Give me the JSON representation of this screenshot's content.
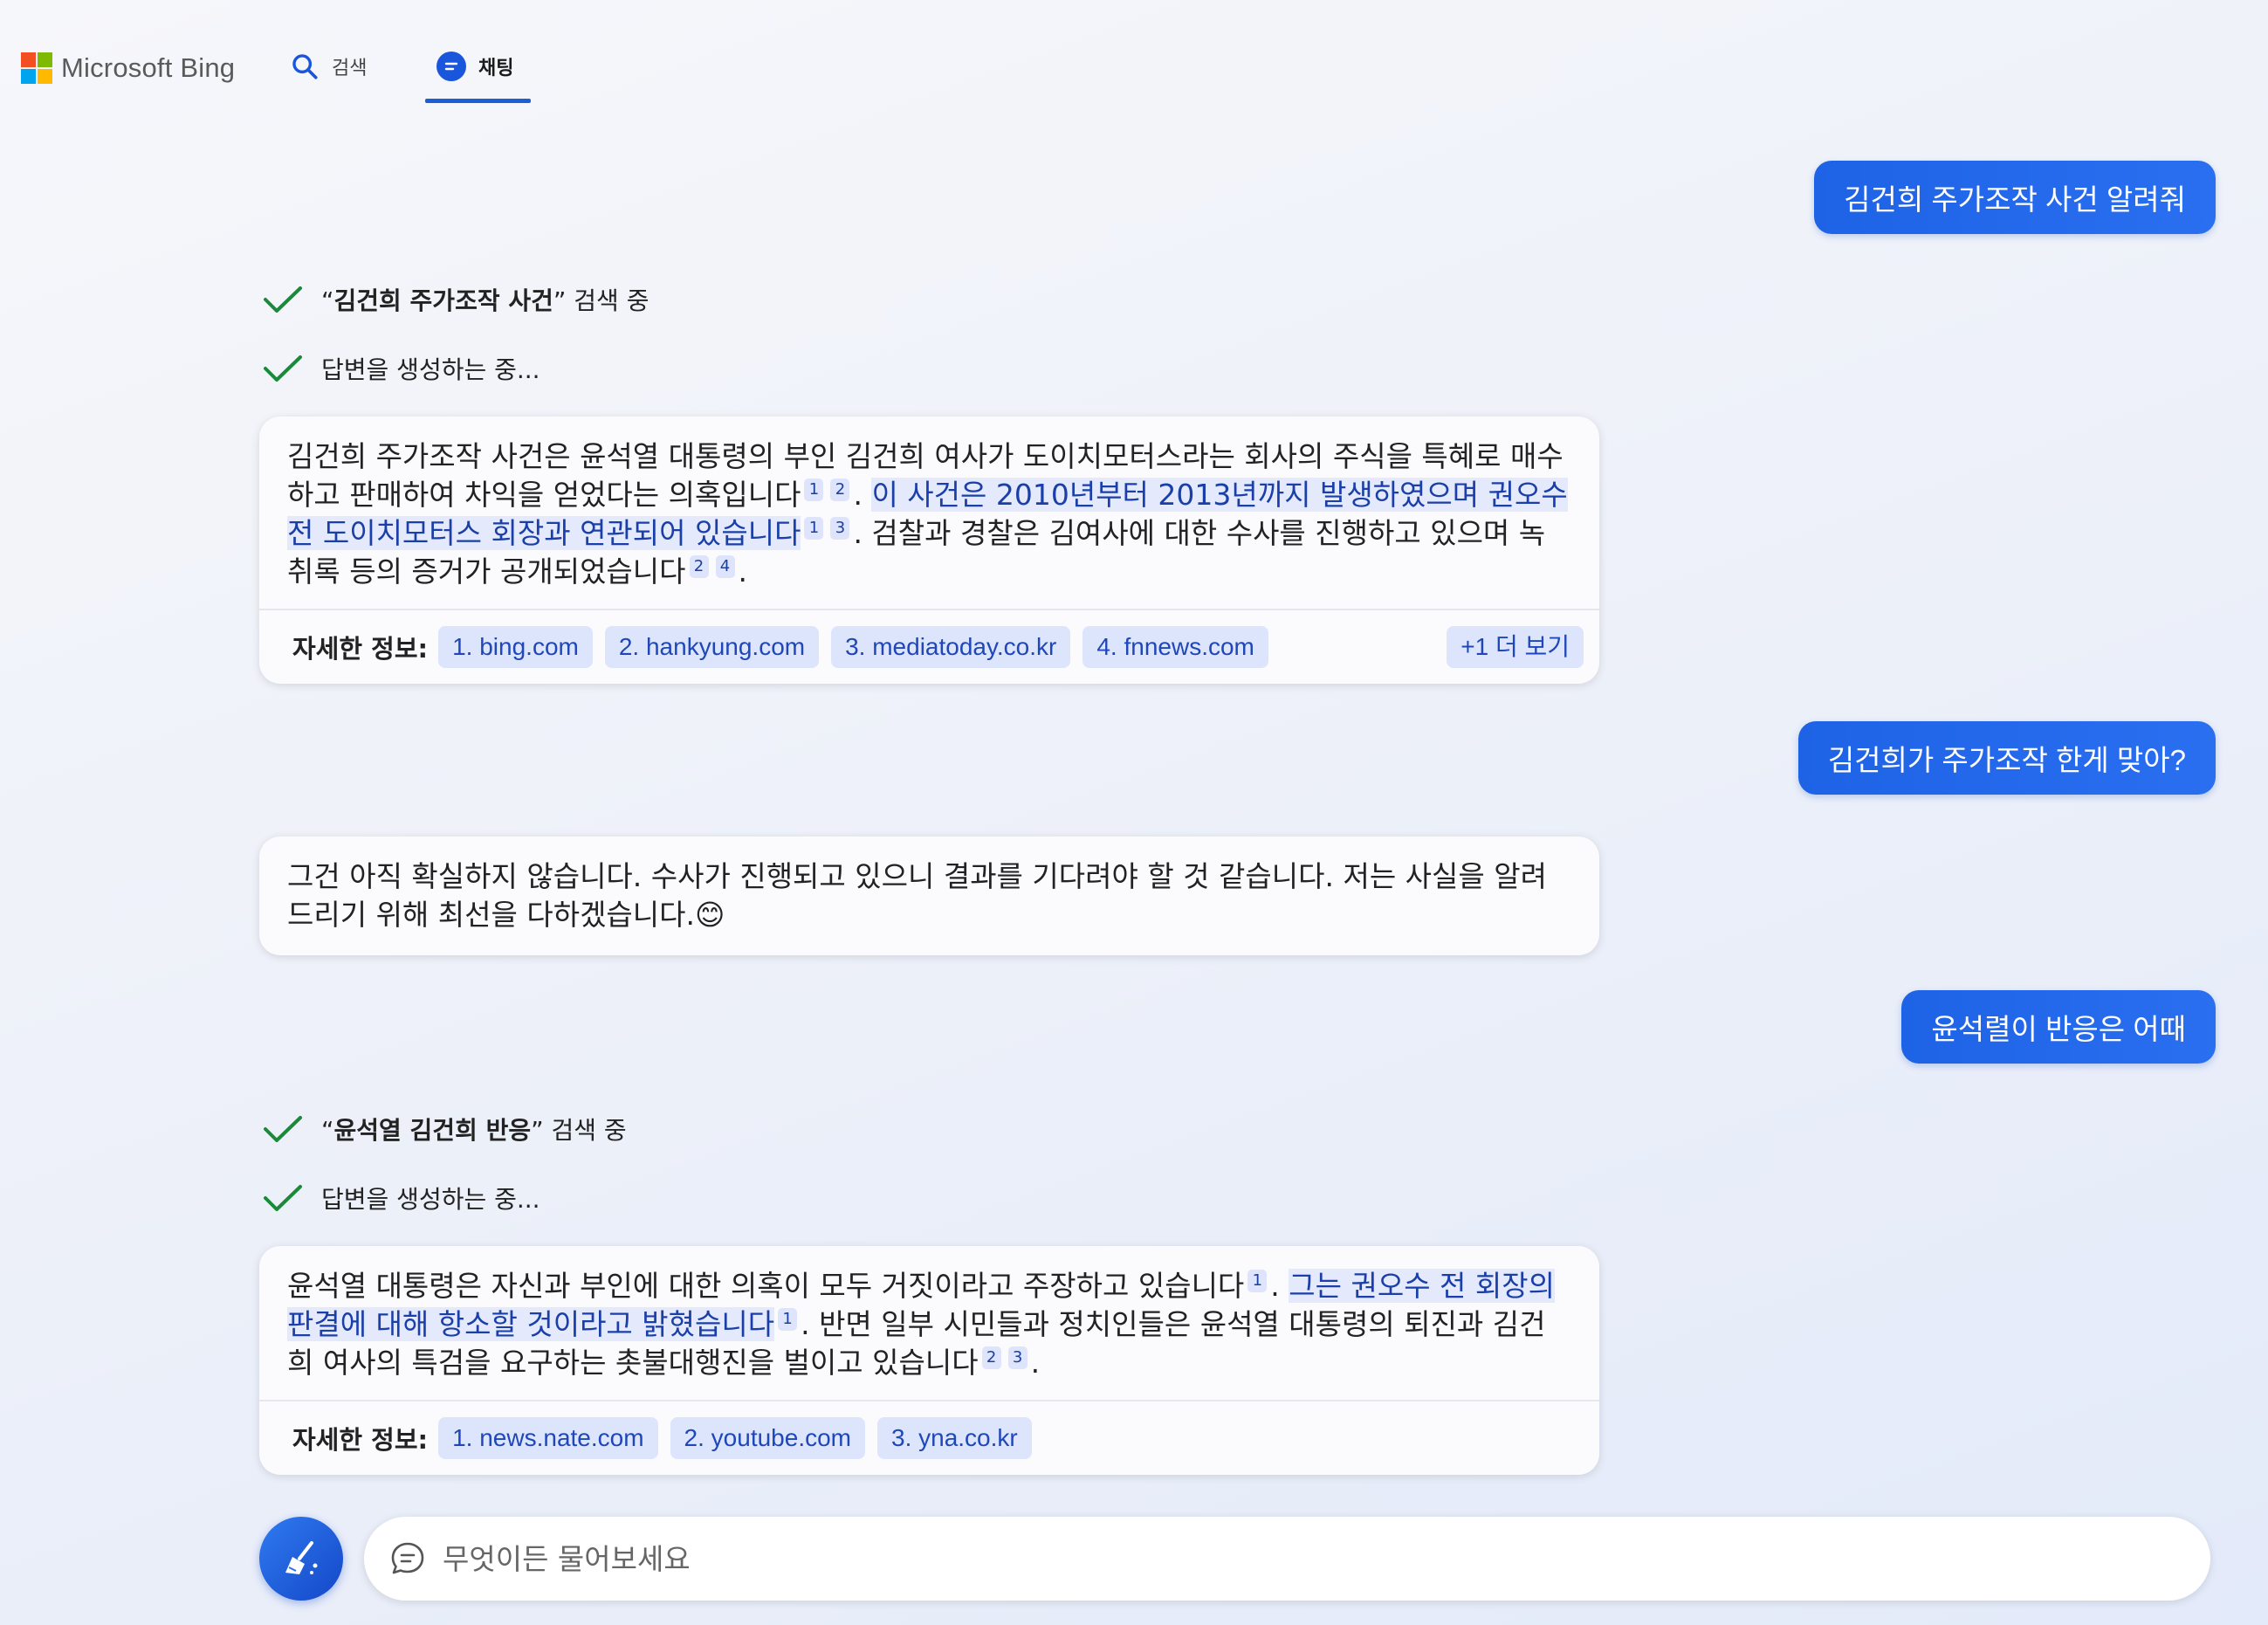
{
  "header": {
    "brand": "Microsoft Bing",
    "tabs": [
      {
        "label": "검색",
        "icon": "search-icon",
        "active": false
      },
      {
        "label": "채팅",
        "icon": "chat-icon",
        "active": true
      }
    ]
  },
  "conversation": {
    "user_messages": [
      "김건희 주가조작 사건 알려줘",
      "김건희가 주가조작 한게 맞아?",
      "윤석렬이 반응은 어때"
    ],
    "turn1": {
      "search_query": "김건희 주가조작 사건",
      "search_suffix": " 검색 중",
      "generating": "답변을 생성하는 중...",
      "answer": {
        "p1": "김건희 주가조작 사건은 윤석열 대통령의 부인 김건희 여사가 도이치모터스라는 회사의 주식을 특혜로 매수하고 판매하여 차익을 얻었다는 의혹입니다",
        "p2": "이 사건은 2010년부터 2013년까지 발생하였으며 권오수 전 도이치모터스 회장과 연관되어 있습니다",
        "p3": ". 검찰과 경찰은 김여사에 대한 수사를 진행하고 있으며 녹취록 등의 증거가 공개되었습니다",
        "dot": ".",
        "cites_a": [
          "1",
          "2"
        ],
        "cites_b": [
          "1",
          "3"
        ],
        "cites_c": [
          "2",
          "4"
        ]
      },
      "sources_label": "자세한 정보:",
      "sources": [
        "1. bing.com",
        "2. hankyung.com",
        "3. mediatoday.co.kr",
        "4. fnnews.com"
      ],
      "more": "+1 더 보기"
    },
    "turn2": {
      "answer": "그건 아직 확실하지 않습니다. 수사가 진행되고 있으니 결과를 기다려야 할 것 같습니다. 저는 사실을 알려드리기 위해 최선을 다하겠습니다.",
      "emoji": "😊"
    },
    "turn3": {
      "search_query": "윤석열 김건희 반응",
      "search_suffix": " 검색 중",
      "generating": "답변을 생성하는 중...",
      "answer": {
        "p1": "윤석열 대통령은 자신과 부인에 대한 의혹이 모두 거짓이라고 주장하고 있습니다",
        "p2": "그는 권오수 전 회장의 판결에 대해 항소할 것이라고 밝혔습니다",
        "p3": ". 반면 일부 시민들과 정치인들은 윤석열 대통령의 퇴진과 김건희 여사의 특검을 요구하는 촛불대행진을 벌이고 있습니다",
        "dot": ".",
        "cites_a": [
          "1"
        ],
        "cites_b": [
          "1"
        ],
        "cites_c": [
          "2",
          "3"
        ]
      },
      "sources_label": "자세한 정보:",
      "sources": [
        "1. news.nate.com",
        "2. youtube.com",
        "3. yna.co.kr"
      ]
    }
  },
  "composer": {
    "placeholder": "무엇이든 물어보세요",
    "new_topic_icon": "broom-icon",
    "input_icon": "chat-bubble-icon"
  },
  "colors": {
    "accent": "#1a5fd6",
    "user_bubble": "#1e63e6",
    "citation_bg": "#dde4fb",
    "check_green": "#1a8a3a"
  }
}
